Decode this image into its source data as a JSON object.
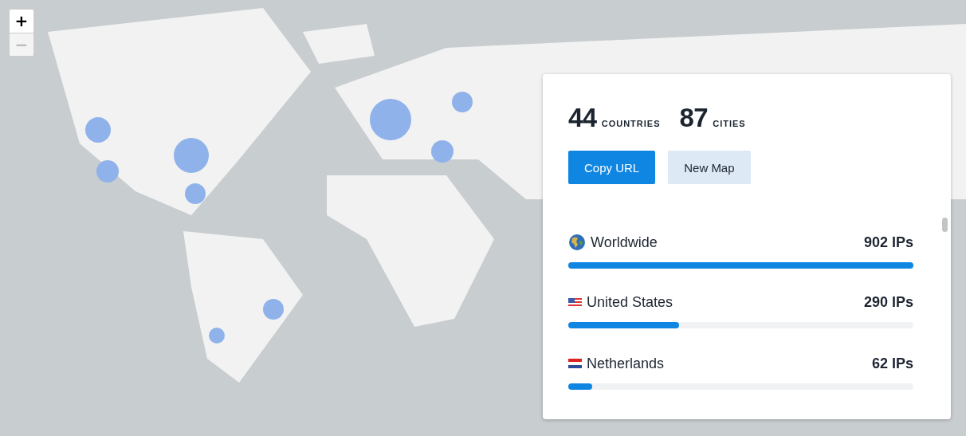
{
  "zoom_controls": [
    {
      "label": "+",
      "disabled": false
    },
    {
      "label": "−",
      "disabled": true
    }
  ],
  "summary": {
    "stats": [
      {
        "value": "44",
        "label": "COUNTRIES"
      },
      {
        "value": "87",
        "label": "CITIES"
      }
    ],
    "buttons": [
      {
        "label": "Copy URL",
        "kind": "primary"
      },
      {
        "label": "New Map",
        "kind": "secondary"
      }
    ],
    "locations": [
      {
        "kind": "globe",
        "name": "Worldwide",
        "count": "902 IPs",
        "level": 1.0
      },
      {
        "kind": "striped",
        "name": "United States",
        "count": "290 IPs",
        "level": 0.32
      },
      {
        "kind": "tricolor",
        "name": "Netherlands",
        "count": "62 IPs",
        "level": 0.07
      }
    ]
  }
}
